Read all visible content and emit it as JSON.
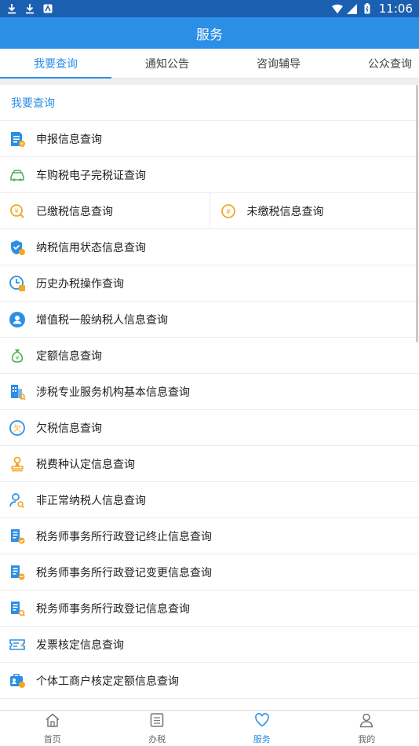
{
  "status_bar": {
    "time": "11:06"
  },
  "app_bar": {
    "title": "服务"
  },
  "tabs": [
    {
      "label": "我要查询",
      "active": true
    },
    {
      "label": "通知公告",
      "active": false
    },
    {
      "label": "咨询辅导",
      "active": false
    },
    {
      "label": "公众查询",
      "active": false
    }
  ],
  "section": {
    "title": "我要查询"
  },
  "items": [
    {
      "label": "申报信息查询",
      "icon": "declare-doc-icon"
    },
    {
      "label": "车购税电子完税证查询",
      "icon": "car-icon"
    },
    {
      "label": "已缴税信息查询",
      "icon": "yuan-search-icon"
    },
    {
      "label": "未缴税信息查询",
      "icon": "yuan-coin-icon"
    },
    {
      "label": "纳税信用状态信息查询",
      "icon": "credit-shield-icon"
    },
    {
      "label": "历史办税操作查询",
      "icon": "history-clock-icon"
    },
    {
      "label": "增值税一般纳税人信息查询",
      "icon": "taxpayer-person-icon"
    },
    {
      "label": "定额信息查询",
      "icon": "money-bag-icon"
    },
    {
      "label": "涉税专业服务机构基本信息查询",
      "icon": "building-search-icon"
    },
    {
      "label": "欠税信息查询",
      "icon": "owed-tax-icon"
    },
    {
      "label": "税费种认定信息查询",
      "icon": "stamp-icon"
    },
    {
      "label": "非正常纳税人信息查询",
      "icon": "person-search-icon"
    },
    {
      "label": "税务师事务所行政登记终止信息查询",
      "icon": "office-doc-icon"
    },
    {
      "label": "税务师事务所行政登记变更信息查询",
      "icon": "office-doc-icon"
    },
    {
      "label": "税务师事务所行政登记信息查询",
      "icon": "office-doc-icon"
    },
    {
      "label": "发票核定信息查询",
      "icon": "invoice-icon"
    },
    {
      "label": "个体工商户核定定额信息查询",
      "icon": "business-card-icon"
    }
  ],
  "bottom_nav": [
    {
      "label": "首页",
      "icon": "home-icon",
      "active": false
    },
    {
      "label": "办税",
      "icon": "list-icon",
      "active": false
    },
    {
      "label": "服务",
      "icon": "heart-icon",
      "active": true
    },
    {
      "label": "我的",
      "icon": "user-icon",
      "active": false
    }
  ],
  "colors": {
    "primary": "#2b8fe6",
    "status_bar": "#1b5fb0",
    "accent_orange": "#f5a623",
    "accent_green": "#4caf50"
  }
}
